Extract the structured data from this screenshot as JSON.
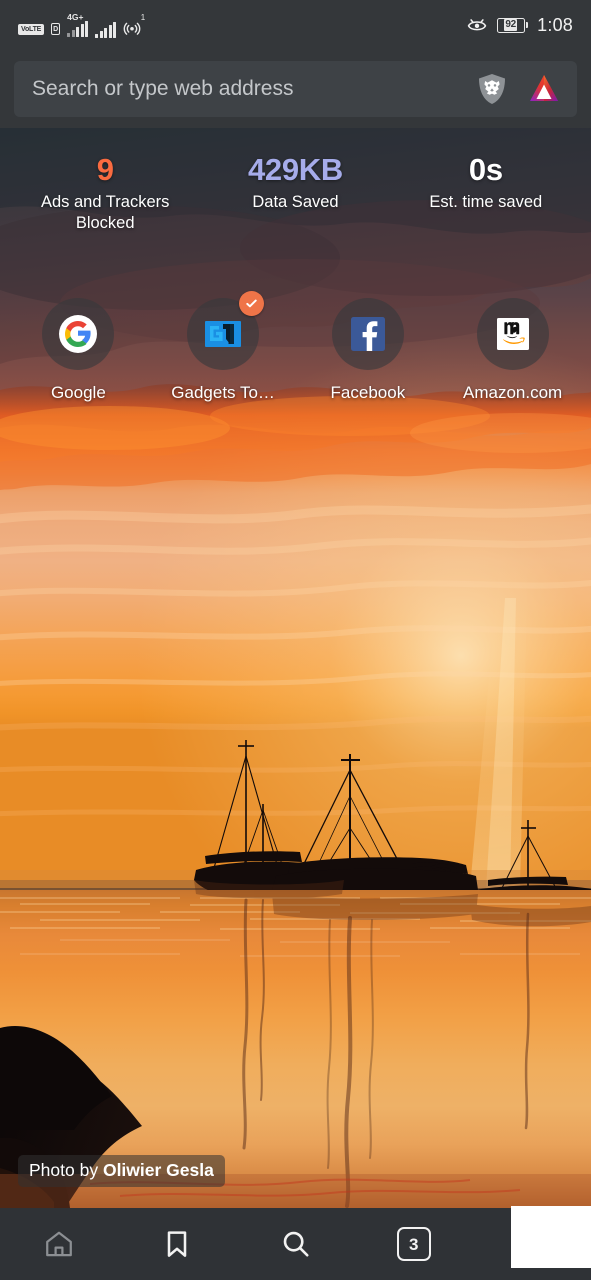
{
  "status_bar": {
    "volte_label": "VoLTE",
    "sim_label": "D",
    "network_label": "4G+",
    "hotspot_superscript": "1",
    "battery_percent": "92",
    "time": "1:08",
    "icons": [
      "volte-icon",
      "sim-icon",
      "signal-bars-icon",
      "signal-bars-secondary-icon",
      "hotspot-icon",
      "eye-comfort-icon",
      "battery-icon"
    ]
  },
  "url_bar": {
    "placeholder": "Search or type web address",
    "shield_icon": "brave-lion-shield-icon",
    "rewards_icon": "brave-rewards-triangle-icon"
  },
  "stats": [
    {
      "value": "9",
      "label": "Ads and Trackers Blocked",
      "color": "#fa6b40"
    },
    {
      "value": "429KB",
      "label": "Data Saved",
      "color": "#a6acea"
    },
    {
      "value": "0s",
      "label": "Est. time saved",
      "color": "#ffffff"
    }
  ],
  "top_sites": [
    {
      "name": "Google",
      "icon": "google-icon",
      "badge": null
    },
    {
      "name": "Gadgets To…",
      "icon": "gadgets-to-icon",
      "badge": "check-badge"
    },
    {
      "name": "Facebook",
      "icon": "facebook-icon",
      "badge": null
    },
    {
      "name": "Amazon.com",
      "icon": "amazon-icon",
      "badge": null
    }
  ],
  "photo_credit": {
    "prefix": "Photo by ",
    "author": "Oliwier Gesla"
  },
  "bottom_nav": [
    {
      "name": "home",
      "icon": "home-icon",
      "label": ""
    },
    {
      "name": "bookmarks",
      "icon": "bookmark-icon",
      "label": ""
    },
    {
      "name": "search",
      "icon": "search-icon",
      "label": ""
    },
    {
      "name": "tabs",
      "icon": "tab-count-icon",
      "label": "3"
    },
    {
      "name": "menu",
      "icon": "menu-icon",
      "label": ""
    }
  ],
  "colors": {
    "chrome": "#34373a",
    "nav_bar": "#2f3236",
    "url_field": "#3e4246",
    "accent_orange": "#fa6b40",
    "accent_lavender": "#a6acea",
    "text_primary": "#ffffff"
  }
}
